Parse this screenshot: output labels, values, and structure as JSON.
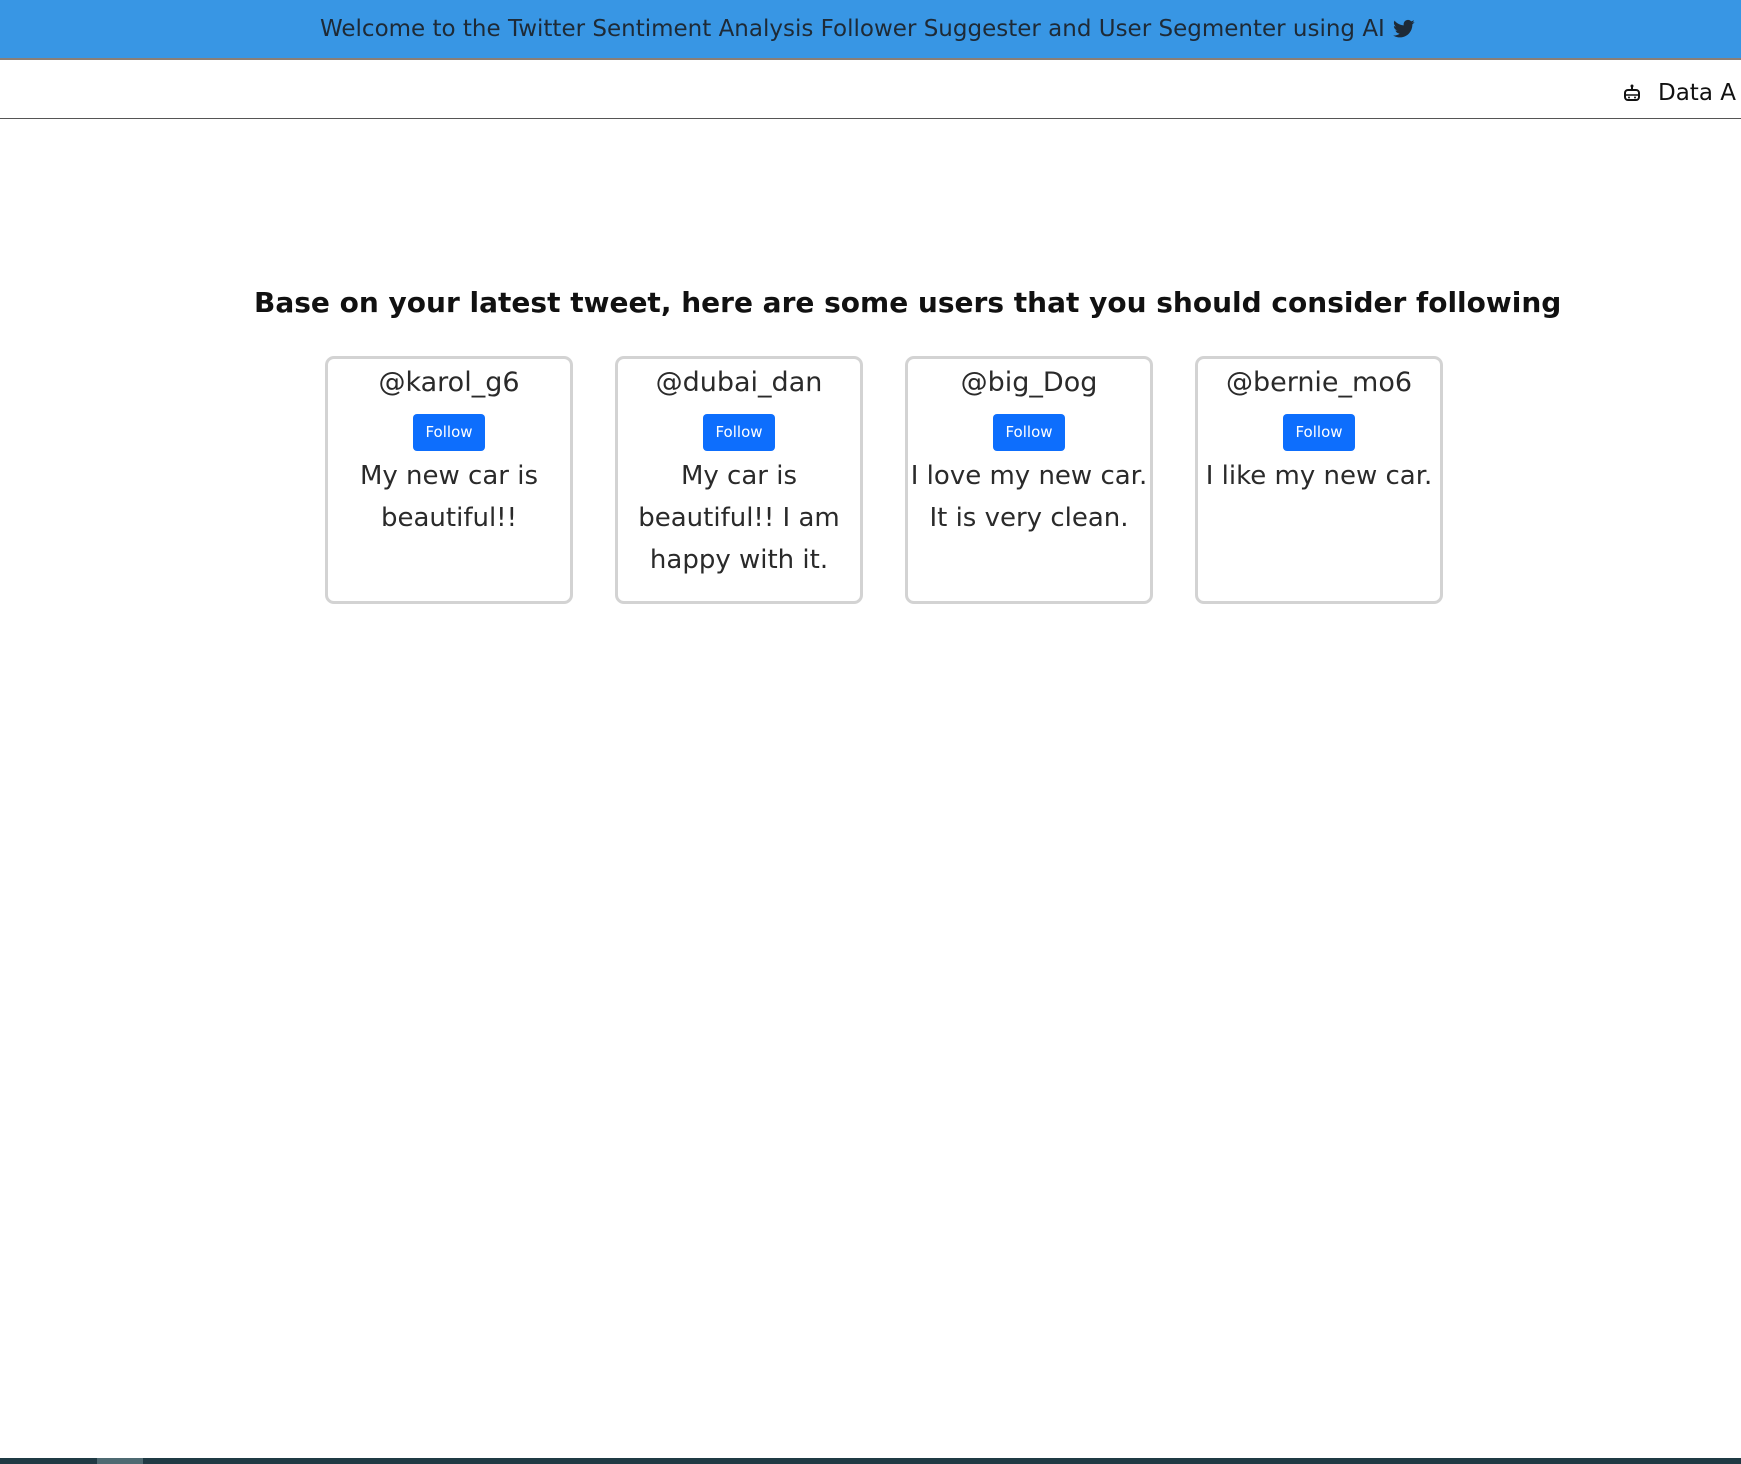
{
  "banner": {
    "text": "Welcome to the Twitter Sentiment Analysis Follower Suggester and User Segmenter using AI",
    "icon": "twitter-bird-icon",
    "color": "#3896e4"
  },
  "navbar": {
    "item_label": "Data A",
    "item_icon": "robot-icon"
  },
  "main": {
    "heading": "Base on your latest tweet, here are some users that you should consider following",
    "cards": [
      {
        "handle": "@karol_g6",
        "button": "Follow",
        "tweet": "My new car is beautiful!!"
      },
      {
        "handle": "@dubai_dan",
        "button": "Follow",
        "tweet": "My car is beautiful!! I am happy with it."
      },
      {
        "handle": "@big_Dog",
        "button": "Follow",
        "tweet": "I love my new car. It is very clean."
      },
      {
        "handle": "@bernie_mo6",
        "button": "Follow",
        "tweet": "I like my new car."
      }
    ],
    "button_color": "#0d6efd"
  }
}
